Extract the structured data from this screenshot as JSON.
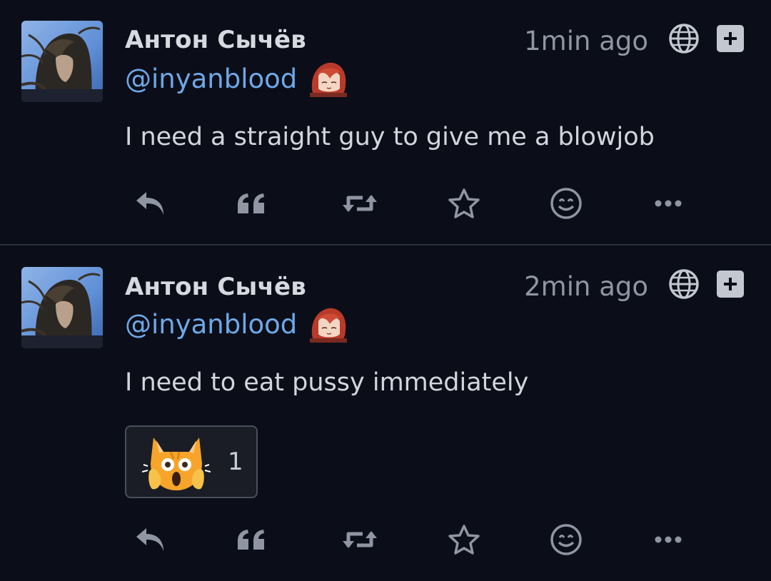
{
  "colors": {
    "background": "#0b0e18",
    "handle": "#6ea8e8",
    "text": "#d2d5dc",
    "muted": "#8f95a3",
    "divider": "#2a2f3c"
  },
  "posts": [
    {
      "display_name": "Антон Сычёв",
      "handle": "@inyanblood",
      "handle_emoji": "anime-girl-emoji",
      "timestamp": "1min ago",
      "visibility_icon": "globe-icon",
      "content": "I need a straight guy to give me a blowjob",
      "reactions": [],
      "actions": [
        "reply-icon",
        "quote-icon",
        "boost-icon",
        "star-icon",
        "emoji-react-icon",
        "more-icon"
      ]
    },
    {
      "display_name": "Антон Сычёв",
      "handle": "@inyanblood",
      "handle_emoji": "anime-girl-emoji",
      "timestamp": "2min ago",
      "visibility_icon": "globe-icon",
      "content": "I need to eat pussy immediately",
      "reactions": [
        {
          "emoji": "screaming-cat-emoji",
          "count": "1"
        }
      ],
      "actions": [
        "reply-icon",
        "quote-icon",
        "boost-icon",
        "star-icon",
        "emoji-react-icon",
        "more-icon"
      ]
    }
  ]
}
